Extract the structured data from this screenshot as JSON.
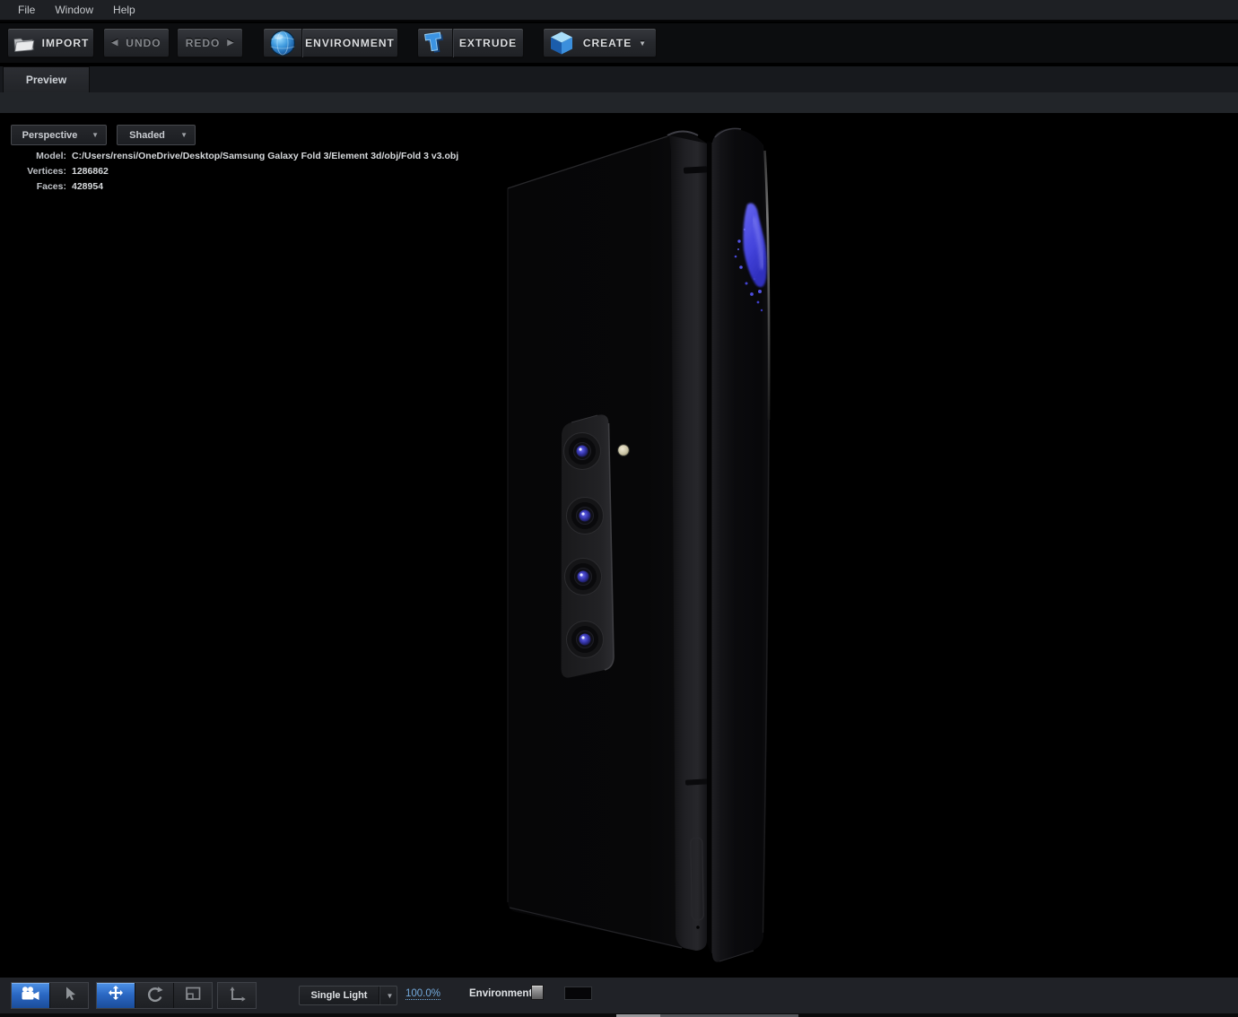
{
  "menu": {
    "file": "File",
    "window": "Window",
    "help": "Help"
  },
  "toolbar": {
    "import": "IMPORT",
    "undo": "UNDO",
    "redo": "REDO",
    "environment": "ENVIRONMENT",
    "extrude": "EXTRUDE",
    "create": "CREATE"
  },
  "tabs": {
    "preview": "Preview"
  },
  "viewport": {
    "camera_mode": "Perspective",
    "shading_mode": "Shaded",
    "info": {
      "model_label": "Model:",
      "model_path": "C:/Users/rensi/OneDrive/Desktop/Samsung Galaxy Fold 3/Element 3d/obj/Fold 3 v3.obj",
      "vertices_label": "Vertices:",
      "vertices": "1286862",
      "faces_label": "Faces:",
      "faces": "428954"
    }
  },
  "bottom": {
    "light_mode": "Single Light",
    "preview_scale": "100.0%",
    "environment_label": "Environment"
  },
  "icons": {
    "undo_arrow": "◀",
    "redo_arrow": "▶",
    "caret_down": "▼",
    "names": [
      "folder-icon",
      "globe-icon",
      "extrude-t-icon",
      "cube-icon",
      "camera-icon",
      "cursor-icon",
      "move-icon",
      "rotate-icon",
      "region-icon",
      "axes-icon"
    ]
  },
  "colors": {
    "active_tool_blue": "#2a67c2",
    "link_blue": "#74aadc",
    "splash_blue": "#4b4bec",
    "globe_blue": "#2e8ad0"
  }
}
